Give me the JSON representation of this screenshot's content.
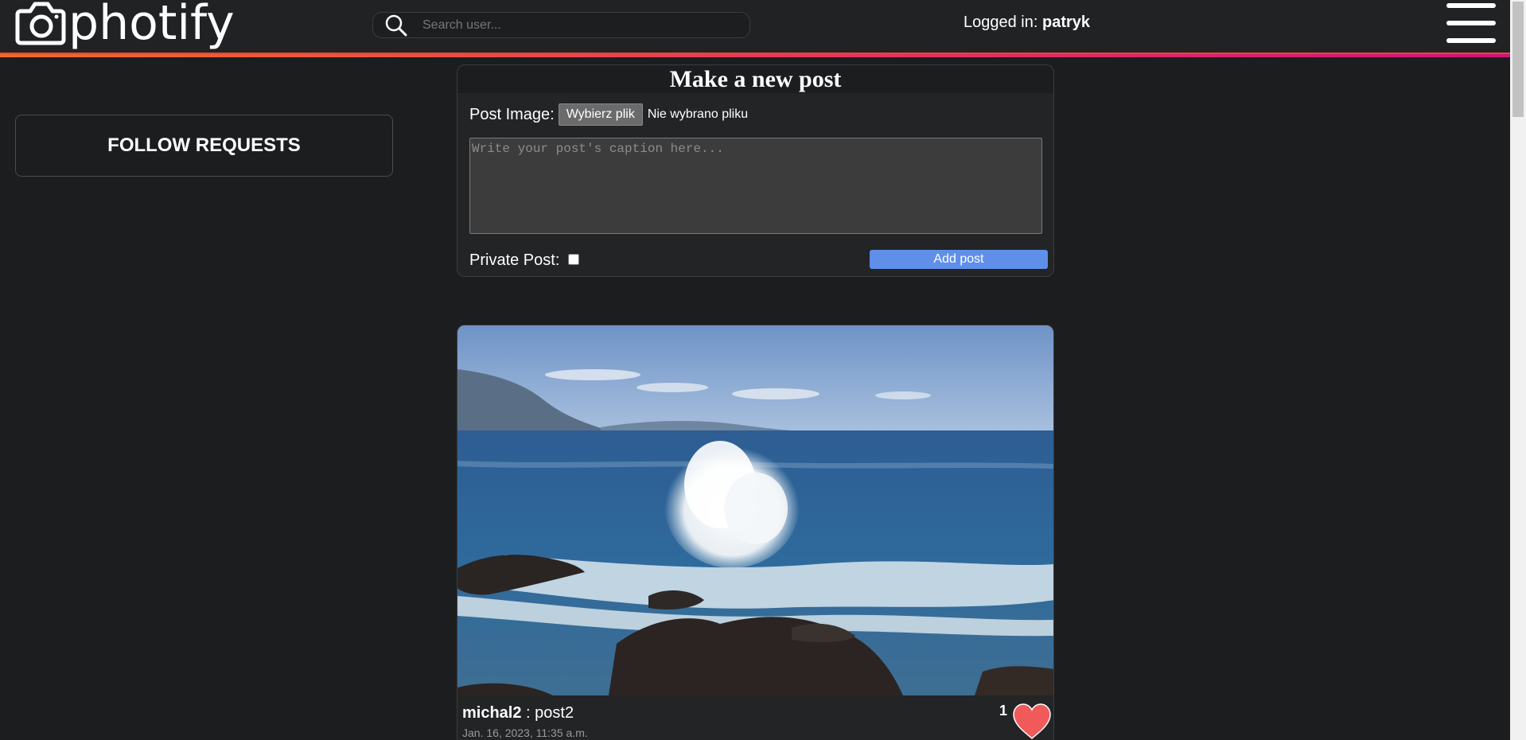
{
  "header": {
    "logo_text": "photify",
    "search_placeholder": "Search user...",
    "logged_label": "Logged in:",
    "username": "patryk"
  },
  "sidebar": {
    "follow_requests_label": "FOLLOW REQUESTS"
  },
  "new_post": {
    "title": "Make a new post",
    "image_label": "Post Image:",
    "file_button_label": "Wybierz plik",
    "file_status": "Nie wybrano pliku",
    "caption_placeholder": "Write your post's caption here...",
    "private_label": "Private Post:",
    "private_checked": false,
    "add_button_label": "Add post"
  },
  "posts": [
    {
      "author": "michal2",
      "separator": " : ",
      "caption": "post2",
      "date": "Jan. 16, 2023, 11:35 a.m.",
      "likes": "1",
      "liked": true,
      "heart_color": "#f05a5a"
    }
  ],
  "icons": {
    "logo": "camera-icon",
    "search": "search-icon",
    "menu": "hamburger-menu-icon",
    "like": "heart-icon"
  },
  "colors": {
    "accent_gradient_start": "#ef6a2a",
    "accent_gradient_end": "#d1127a",
    "add_button": "#5f8fe8",
    "background": "#1c1d1f"
  }
}
